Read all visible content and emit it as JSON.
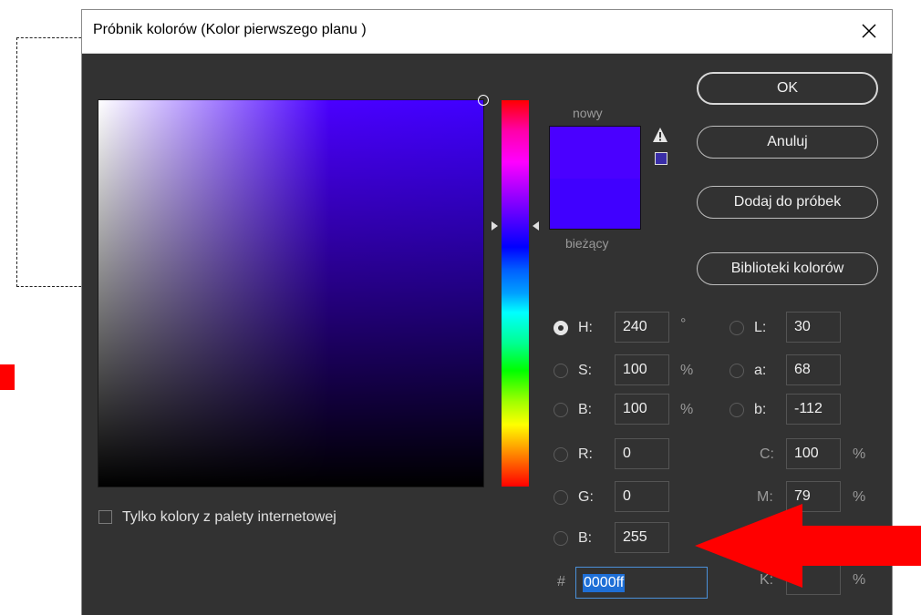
{
  "window": {
    "title": "Próbnik kolorów (Kolor pierwszego planu )"
  },
  "preview": {
    "new_label": "nowy",
    "current_label": "bieżący",
    "new_color": "#4a00ff",
    "current_color": "#4000ff"
  },
  "buttons": {
    "ok": "OK",
    "cancel": "Anuluj",
    "add_to_swatches": "Dodaj do próbek",
    "color_libraries": "Biblioteki kolorów"
  },
  "hsb": {
    "h": {
      "label": "H:",
      "value": "240",
      "unit": "°"
    },
    "s": {
      "label": "S:",
      "value": "100",
      "unit": "%"
    },
    "b": {
      "label": "B:",
      "value": "100",
      "unit": "%"
    }
  },
  "rgb": {
    "r": {
      "label": "R:",
      "value": "0"
    },
    "g": {
      "label": "G:",
      "value": "0"
    },
    "b": {
      "label": "B:",
      "value": "255"
    }
  },
  "lab": {
    "l": {
      "label": "L:",
      "value": "30"
    },
    "a": {
      "label": "a:",
      "value": "68"
    },
    "b": {
      "label": "b:",
      "value": "-112"
    }
  },
  "cmyk": {
    "c": {
      "label": "C:",
      "value": "100",
      "unit": "%"
    },
    "m": {
      "label": "M:",
      "value": "79",
      "unit": "%"
    },
    "k": {
      "label": "K:",
      "value": "",
      "unit": "%"
    }
  },
  "hex": {
    "label": "#",
    "value": "0000ff"
  },
  "web_colors_only": {
    "label": "Tylko kolory z palety internetowej",
    "checked": false
  },
  "selected_channel": "H",
  "annotation_color": "#ff0000"
}
